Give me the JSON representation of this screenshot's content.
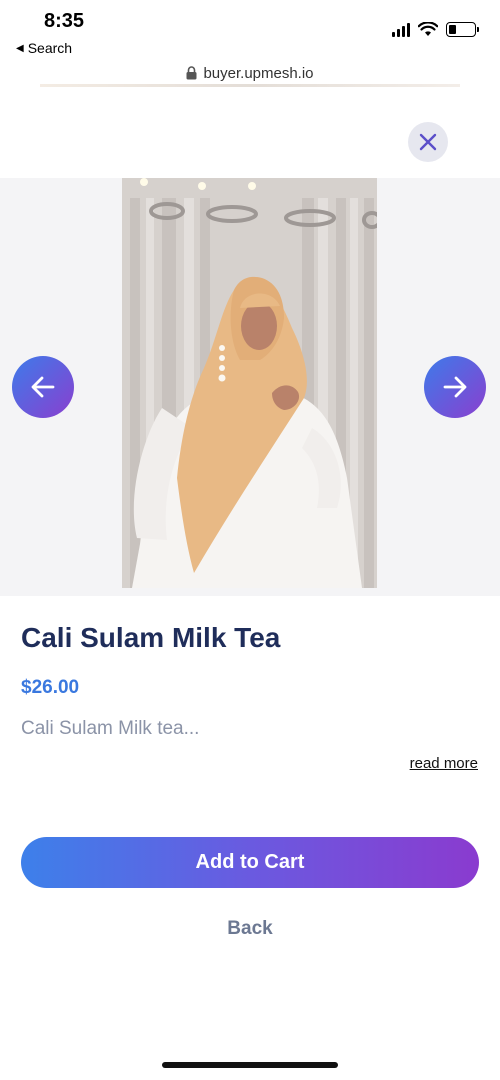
{
  "status_bar": {
    "time": "8:35",
    "back_app_label": "Search"
  },
  "browser": {
    "url": "buyer.upmesh.io"
  },
  "product": {
    "name": "Cali Sulam Milk Tea",
    "price": "$26.00",
    "description": "Cali Sulam Milk tea...",
    "read_more_label": "read more"
  },
  "actions": {
    "add_to_cart_label": "Add to Cart",
    "back_label": "Back"
  },
  "icons": {
    "close": "close-icon",
    "prev": "arrow-left-icon",
    "next": "arrow-right-icon"
  },
  "colors": {
    "accent_blue": "#3d80ea",
    "accent_purple": "#8a3bcf",
    "title": "#1f2d5a",
    "price": "#3a78df",
    "muted": "#8b93a7"
  }
}
